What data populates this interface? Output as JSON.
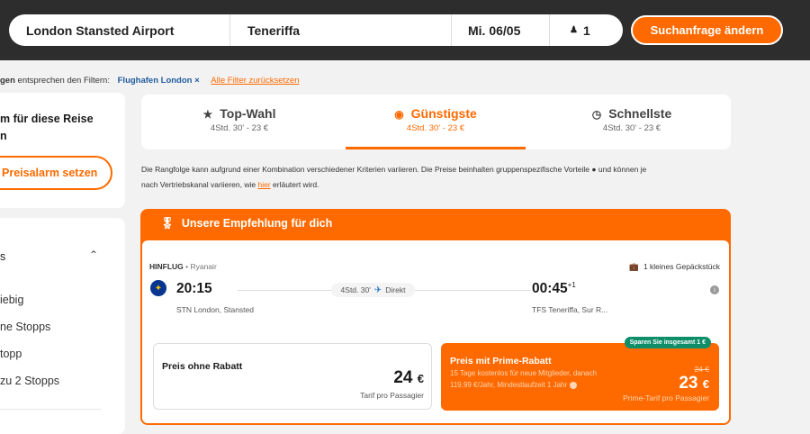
{
  "search": {
    "origin": "London Stansted Airport",
    "destination": "Teneriffa",
    "date": "Mi. 06/05",
    "passengers": "1",
    "change_button": "Suchanfrage ändern"
  },
  "filters": {
    "prefix_bold": "gen",
    "text": " entsprechen den Filtern:",
    "chip": "Flughafen London ×",
    "reset": "Alle Filter zurücksetzen"
  },
  "sidebar": {
    "alarm_title_1": "m für diese Reise",
    "alarm_title_2": "n",
    "alarm_button": "Preisalarm setzen",
    "stops_header": "s",
    "options": [
      "iebig",
      "ne Stopps",
      "topp",
      " zu 2 Stopps"
    ]
  },
  "tabs": [
    {
      "label": "Top-Wahl",
      "sub": "4Std. 30' - 23 €",
      "icon": "star-icon"
    },
    {
      "label": "Günstigste",
      "sub": "4Std. 30' - 23 €",
      "icon": "piggy-bank-icon"
    },
    {
      "label": "Schnellste",
      "sub": "4Std. 30' - 23 €",
      "icon": "clock-icon"
    }
  ],
  "note": {
    "line1": "Die Rangfolge kann aufgrund einer Kombination verschiedener Kriterien variieren. Die Preise beinhalten gruppenspezifische Vorteile ● und können je",
    "line2_a": "nach Vertriebskanal variieren, wie ",
    "link": "hier",
    "line2_b": " erläutert wird."
  },
  "recommendation": {
    "title": "Unsere Empfehlung für dich",
    "leg_label": "HINFLUG",
    "airline": " • Ryanair",
    "baggage": "1 kleines Gepäckstück",
    "departure_time": "20:15",
    "departure_airport": "STN London, Stansted",
    "duration": "4Std. 30'",
    "stops": "Direkt",
    "arrival_time": "00:45",
    "arrival_day_offset": "+1",
    "arrival_airport": "TFS Teneriffa, Sur R...",
    "price_standard": {
      "label": "Preis ohne Rabatt",
      "value": "24",
      "currency": "€",
      "sub": "Tarif pro Passagier"
    },
    "price_prime": {
      "badge": "Sparen Sie insgesamt 1 €",
      "label": "Preis mit Prime-Rabatt",
      "desc1": "15 Tage kostenlos für neue Mitglieder, danach",
      "desc2": "119,99 €/Jahr, Mindestlaufzeit 1 Jahr",
      "old_price": "24 €",
      "value": "23",
      "currency": "€",
      "sub": "Prime-Tarif pro Passagier"
    }
  },
  "colors": {
    "accent": "#ff6a00",
    "topbar": "#2d2d2d",
    "badge": "#0f8e6a"
  }
}
